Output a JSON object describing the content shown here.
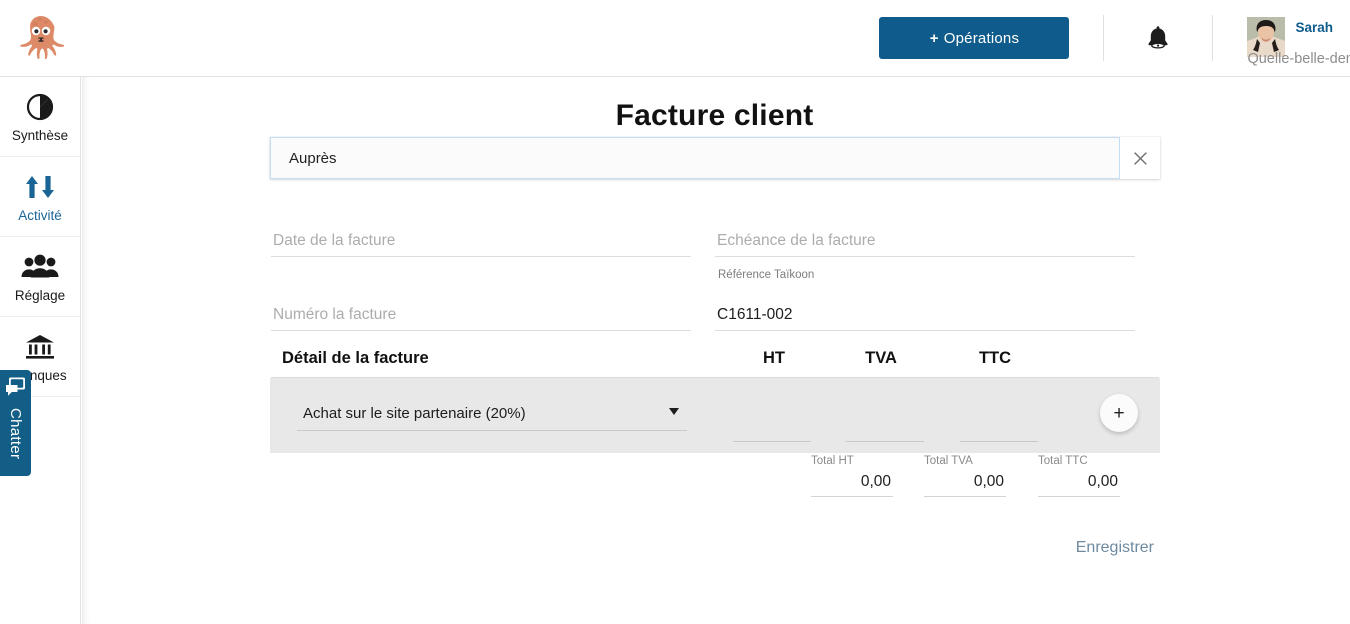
{
  "header": {
    "logo_alt": "octopus-logo",
    "operations_button": "Opérations",
    "operations_plus": "+",
    "user_name": "Sarah",
    "organization": "Quelle-belle-demo"
  },
  "sidebar": {
    "items": [
      {
        "label": "Synthèse",
        "icon": "pie-chart-icon",
        "active": false
      },
      {
        "label": "Activité",
        "icon": "arrows-up-down-icon",
        "active": true
      },
      {
        "label": "Réglage",
        "icon": "people-group-icon",
        "active": false
      },
      {
        "label": "Banques",
        "icon": "bank-icon",
        "active": false
      }
    ]
  },
  "chatter": {
    "label": "Chatter",
    "icon": "chat-bubble-icon"
  },
  "main": {
    "title": "Facture client",
    "search": {
      "value": "Auprès",
      "placeholder": "",
      "clear_icon": "close-icon"
    },
    "fields": {
      "date_placeholder": "Date de la facture",
      "date_value": "",
      "echeance_placeholder": "Echéance de la facture",
      "echeance_value": "",
      "numero_placeholder": "Numéro la facture",
      "numero_value": "",
      "reference_label": "Référence Taïkoon",
      "reference_value": "C1611-002"
    },
    "detail": {
      "title": "Détail de la facture",
      "columns": {
        "ht": "HT",
        "tva": "TVA",
        "ttc": "TTC"
      },
      "rows": [
        {
          "category": "Achat sur le site partenaire (20%)",
          "ht": "",
          "tva": "",
          "ttc": ""
        }
      ],
      "add_button": "+"
    },
    "totals": {
      "ht_label": "Total HT",
      "ht_value": "0,00",
      "tva_label": "Total TVA",
      "tva_value": "0,00",
      "ttc_label": "Total TTC",
      "ttc_value": "0,00"
    },
    "save_button": "Enregistrer"
  },
  "colors": {
    "brand_blue": "#0f5c8c",
    "accent_blue": "#1a6496",
    "detail_row_bg": "#e8e8e8",
    "save_text": "#6e8aa0",
    "logo_orange": "#d9805f"
  }
}
